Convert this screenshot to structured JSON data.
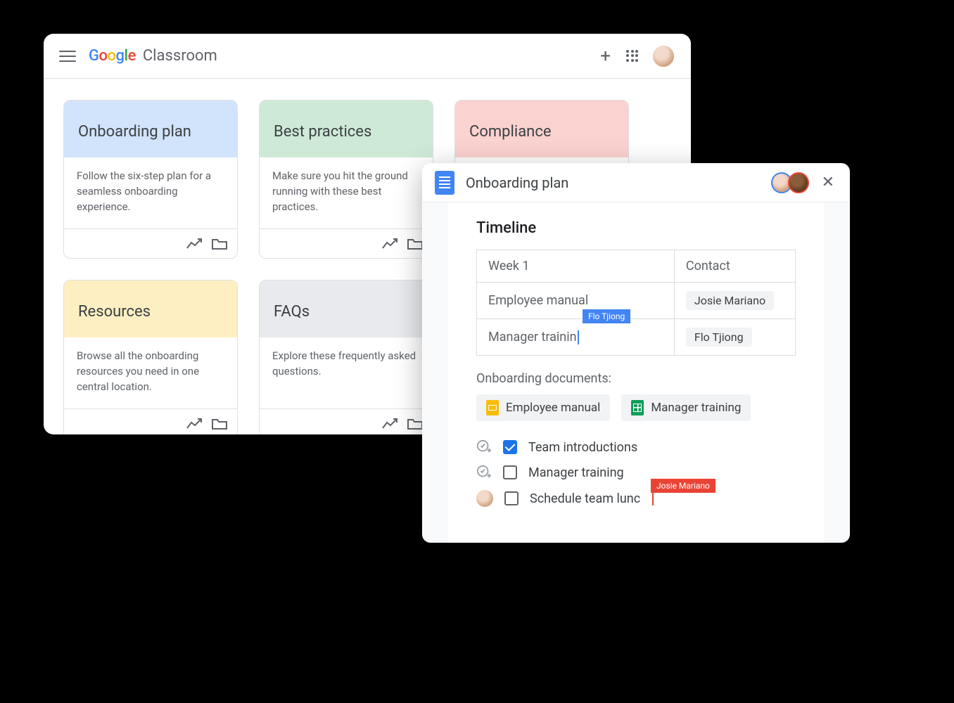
{
  "classroom": {
    "brand": "Google",
    "product": "Classroom",
    "cards": [
      {
        "title": "Onboarding plan",
        "desc": "Follow the six-step plan for a seamless onboarding experience.",
        "color": "c-blue"
      },
      {
        "title": "Best practices",
        "desc": "Make sure you hit the ground running with these best practices.",
        "color": "c-green"
      },
      {
        "title": "Compliance",
        "desc": "",
        "color": "c-pink"
      },
      {
        "title": "Resources",
        "desc": "Browse all the onboarding resources you need in one central location.",
        "color": "c-yellow"
      },
      {
        "title": "FAQs",
        "desc": "Explore these frequently asked questions.",
        "color": "c-grey"
      }
    ]
  },
  "docs": {
    "title": "Onboarding plan",
    "section_title": "Timeline",
    "table": {
      "header": {
        "col1": "Week 1",
        "col2": "Contact"
      },
      "rows": [
        {
          "task": "Employee manual",
          "contact": "Josie Mariano"
        },
        {
          "task": "Manager trainin",
          "contact": "Flo Tjiong"
        }
      ]
    },
    "cursor_tags": {
      "blue_name": "Flo Tjiong",
      "red_name": "Josie Mariano"
    },
    "onb_docs_label": "Onboarding documents:",
    "doc_chips": [
      {
        "name": "Employee manual",
        "type": "slides"
      },
      {
        "name": "Manager training",
        "type": "sheets"
      }
    ],
    "checklist": [
      {
        "label": "Team introductions",
        "checked": true,
        "prefix": "add"
      },
      {
        "label": "Manager training",
        "checked": false,
        "prefix": "add"
      },
      {
        "label": "Schedule team lunc",
        "checked": false,
        "prefix": "avatar"
      }
    ]
  }
}
